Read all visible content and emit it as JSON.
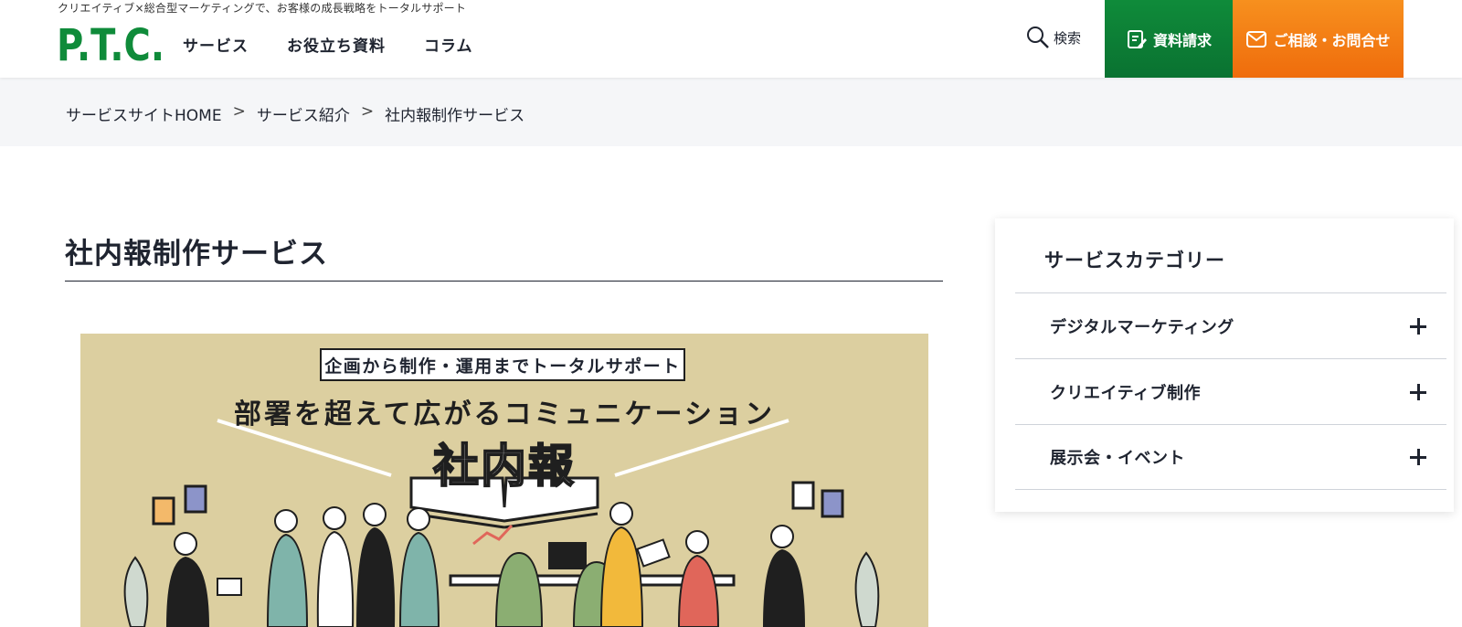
{
  "header": {
    "tagline": "クリエイティブ×総合型マーケティングで、お客様の成長戦略をトータルサポート",
    "logo_text": "P.T.C.",
    "nav": [
      "サービス",
      "お役立ち資料",
      "コラム"
    ],
    "search_label": "検索",
    "doc_request_label": "資料請求",
    "contact_label": "ご相談・お問合せ",
    "colors": {
      "green": "#0a7231",
      "orange": "#ef6c0c"
    }
  },
  "breadcrumb": {
    "items": [
      "サービスサイトHOME",
      "サービス紹介",
      "社内報制作サービス"
    ],
    "separator": ">"
  },
  "main": {
    "title": "社内報制作サービス",
    "hero": {
      "tag": "企画から制作・運用までトータルサポート",
      "headline": "部署を超えて広がるコミュニケーション",
      "main_text": "社内報",
      "background": "#dccfa0"
    }
  },
  "sidebar": {
    "title": "サービスカテゴリー",
    "categories": [
      "デジタルマーケティング",
      "クリエイティブ制作",
      "展示会・イベント"
    ]
  }
}
